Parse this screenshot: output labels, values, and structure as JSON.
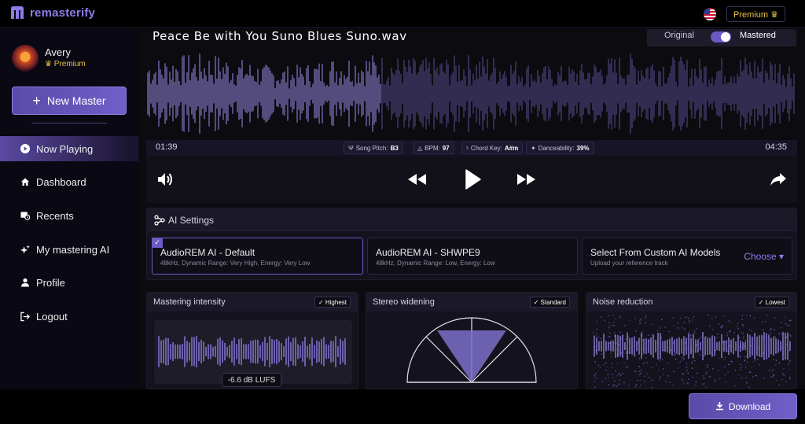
{
  "app": {
    "logo_text": "remasterify",
    "premium_button": "Premium ♛"
  },
  "sidebar": {
    "user_name": "Avery",
    "user_plan": "♛ Premium",
    "new_master_label": "New Master",
    "items": [
      {
        "label": "Now Playing",
        "icon": "play-circle-icon",
        "active": true
      },
      {
        "label": "Dashboard",
        "icon": "home-icon",
        "active": false
      },
      {
        "label": "Recents",
        "icon": "recents-icon",
        "active": false
      },
      {
        "label": "My mastering AI",
        "icon": "sparkle-icon",
        "active": false
      },
      {
        "label": "Profile",
        "icon": "user-icon",
        "active": false
      },
      {
        "label": "Logout",
        "icon": "logout-icon",
        "active": false
      }
    ]
  },
  "player": {
    "track_title": "Peace Be with You Suno Blues Suno.wav",
    "toggle_original": "Original",
    "toggle_mastered": "Mastered",
    "toggle_on": true,
    "time_current": "01:39",
    "time_total": "04:35",
    "song_pitch_label": "Song Pitch:",
    "song_pitch_value": "B3",
    "bpm_label": "BPM:",
    "bpm_value": "97",
    "chord_key_label": "Chord Key:",
    "chord_key_value": "A#m",
    "danceability_label": "Danceability:",
    "danceability_value": "39%"
  },
  "ai_settings": {
    "title": "AI Settings",
    "models": [
      {
        "name": "AudioREM AI - Default",
        "desc": "48kHz, Dynamic Range: Very High, Energy: Very Low",
        "selected": true
      },
      {
        "name": "AudioREM AI - SHWPE9",
        "desc": "48kHz, Dynamic Range: Low, Energy: Low",
        "selected": false
      },
      {
        "name": "Select From Custom AI Models",
        "desc": "Upload your reference track",
        "selected": false
      }
    ],
    "choose_label": "Choose ▾"
  },
  "panels": {
    "intensity": {
      "title": "Mastering intensity",
      "badge": "✓ Highest",
      "lufs": "-6.6 dB LUFS"
    },
    "stereo": {
      "title": "Stereo widening",
      "badge": "✓ Standard"
    },
    "noise": {
      "title": "Noise reduction",
      "badge": "✓ Lowest"
    }
  },
  "footer": {
    "download_label": "Download"
  },
  "colors": {
    "accent": "#6a5cc6",
    "premium": "#e8c14a",
    "wave": "#8b7de0"
  }
}
